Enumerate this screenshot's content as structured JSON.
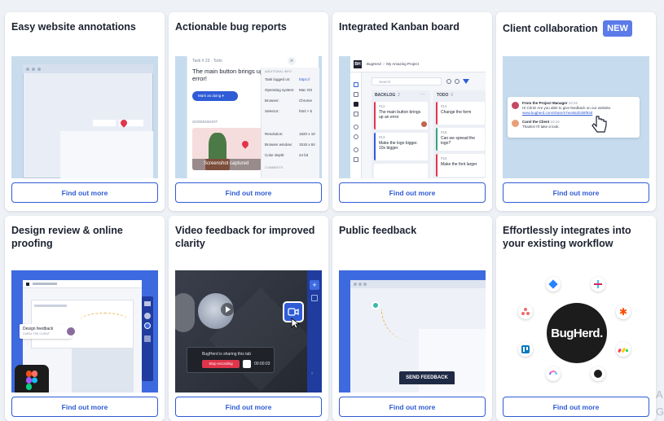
{
  "cards": [
    {
      "title": "Easy website annotations",
      "button": "Find out more"
    },
    {
      "title": "Actionable bug reports",
      "button": "Find out more"
    },
    {
      "title": "Integrated Kanban board",
      "button": "Find out more"
    },
    {
      "title": "Client collaboration",
      "badge": "NEW",
      "button": "Find out more"
    },
    {
      "title": "Design review & online proofing",
      "button": "Find out more"
    },
    {
      "title": "Video feedback for improved clarity",
      "button": "Find out more"
    },
    {
      "title": "Public feedback",
      "button": "Find out more"
    },
    {
      "title": "Effortlessly integrates into your existing workflow",
      "button": "Find out more"
    }
  ],
  "bug_report": {
    "task_header": "Task # 23 · Todo",
    "heading": "The main button brings up an error!",
    "status_button": "Mark as doing",
    "screenshot_label": "SCREENSHOT",
    "screenshot_caption": "Screenshot captured",
    "details_header": "ADDITIONAL INFO",
    "details": [
      {
        "label": "Task logged on:",
        "value": "https://"
      },
      {
        "label": "Operating system:",
        "value": "Mac OS"
      },
      {
        "label": "Browser:",
        "value": "Chrome"
      },
      {
        "label": "Selector:",
        "value": "html > b"
      },
      {
        "label": "Resolution:",
        "value": "1920 x 10"
      },
      {
        "label": "Browser window:",
        "value": "1515 x 84"
      },
      {
        "label": "Color depth:",
        "value": "24 bit"
      }
    ],
    "comments_label": "COMMENTS",
    "close_glyph": "×"
  },
  "kanban": {
    "logo": "BH",
    "breadcrumb": "BugHerd  ›  My Amazing Project",
    "search_placeholder": "Search",
    "backlog_label": "BACKLOG",
    "backlog_count": "2",
    "todo_label": "TODO",
    "todo_count": "3",
    "backlog_cards": [
      {
        "id": "#12",
        "text": "The main button brings up an error"
      },
      {
        "id": "#13",
        "text": "Make the logo bigger. 10x bigger."
      }
    ],
    "todo_cards": [
      {
        "id": "#14",
        "text": "Change the form"
      },
      {
        "id": "#15",
        "text": "Can we spread the logo?"
      },
      {
        "id": "#16",
        "text": "Make the font larger"
      }
    ]
  },
  "collab": {
    "msg1_name": "From the Project Manager",
    "msg1_time": "10:32",
    "msg1_text": "Hi Chris! Are you able to give feedback on our website.",
    "msg1_link": "www.bugherd.com/share/n7wo8a2b3i8f93d",
    "msg2_name": "Carol the Client",
    "msg2_time": "10:44",
    "msg2_text": "Thanks! I'll take a look."
  },
  "design": {
    "figma_tag": "Design feedback",
    "figma_sub": "CARAL THE CLIENT"
  },
  "video": {
    "share_text": "BugHerd is sharing this tab",
    "stop_label": "Stop recording",
    "timer": "00:00:03"
  },
  "public": {
    "send_feedback": "SEND FEEDBACK"
  },
  "integrations": {
    "logo_text": "BugHerd."
  },
  "edge_letters": [
    "A",
    "G"
  ],
  "colors": {
    "accent": "#2f5cd6",
    "card_bg_blue": "#c6dcee",
    "dark_blue": "#1f3c9e",
    "red": "#e0354b"
  }
}
